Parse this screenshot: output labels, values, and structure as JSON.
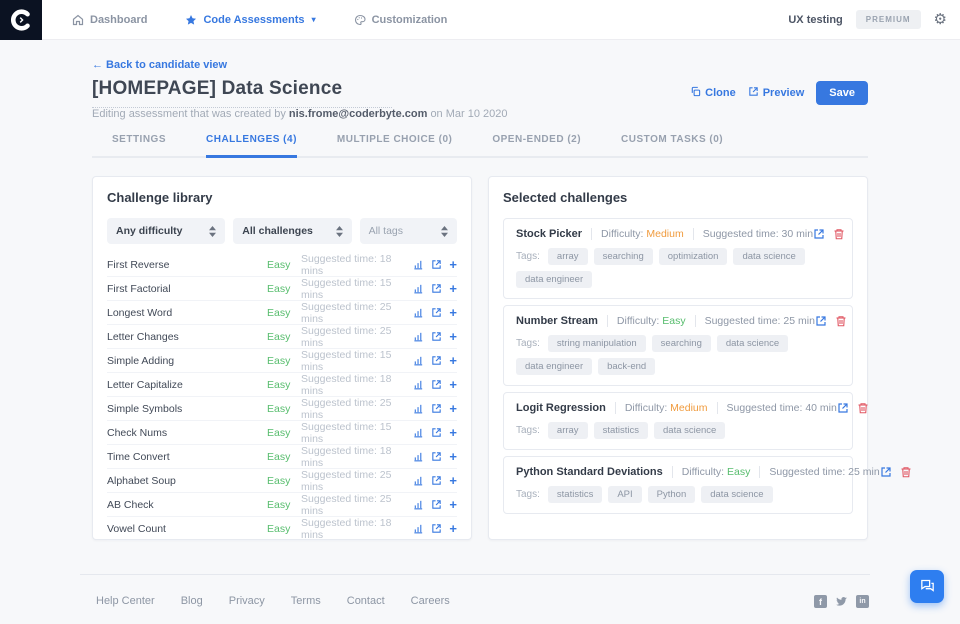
{
  "navbar": {
    "logo_icon": "coderbyte-logo",
    "items": [
      {
        "label": "Dashboard",
        "icon": "home-icon"
      },
      {
        "label": "Code Assessments",
        "icon": "star-icon",
        "has_caret": true
      },
      {
        "label": "Customization",
        "icon": "palette-icon"
      }
    ],
    "workspace": "UX testing",
    "plan_badge": "PREMIUM",
    "settings_icon": "gear-icon"
  },
  "header": {
    "back_link": "← Back to candidate view",
    "title": "[HOMEPAGE] Data Science",
    "subtitle_prefix": "Editing assessment that was created by",
    "subtitle_email": "nis.frome@coderbyte.com",
    "subtitle_suffix": "on Mar 10 2020",
    "actions": {
      "clone": "Clone",
      "preview": "Preview",
      "save": "Save"
    }
  },
  "tabs": [
    {
      "label": "SETTINGS",
      "active": false
    },
    {
      "label": "CHALLENGES (4)",
      "active": true
    },
    {
      "label": "MULTIPLE CHOICE (0)",
      "active": false
    },
    {
      "label": "OPEN-ENDED (2)",
      "active": false
    },
    {
      "label": "CUSTOM TASKS (0)",
      "active": false
    }
  ],
  "library": {
    "title": "Challenge library",
    "filters": [
      {
        "value": "Any difficulty"
      },
      {
        "value": "All challenges"
      },
      {
        "value": "All tags"
      }
    ],
    "challenges": [
      {
        "name": "First Reverse",
        "difficulty": "Easy",
        "time": "Suggested time: 18 mins"
      },
      {
        "name": "First Factorial",
        "difficulty": "Easy",
        "time": "Suggested time: 15 mins"
      },
      {
        "name": "Longest Word",
        "difficulty": "Easy",
        "time": "Suggested time: 25 mins"
      },
      {
        "name": "Letter Changes",
        "difficulty": "Easy",
        "time": "Suggested time: 25 mins"
      },
      {
        "name": "Simple Adding",
        "difficulty": "Easy",
        "time": "Suggested time: 15 mins"
      },
      {
        "name": "Letter Capitalize",
        "difficulty": "Easy",
        "time": "Suggested time: 18 mins"
      },
      {
        "name": "Simple Symbols",
        "difficulty": "Easy",
        "time": "Suggested time: 25 mins"
      },
      {
        "name": "Check Nums",
        "difficulty": "Easy",
        "time": "Suggested time: 15 mins"
      },
      {
        "name": "Time Convert",
        "difficulty": "Easy",
        "time": "Suggested time: 18 mins"
      },
      {
        "name": "Alphabet Soup",
        "difficulty": "Easy",
        "time": "Suggested time: 25 mins"
      },
      {
        "name": "AB Check",
        "difficulty": "Easy",
        "time": "Suggested time: 25 mins"
      },
      {
        "name": "Vowel Count",
        "difficulty": "Easy",
        "time": "Suggested time: 18 mins"
      }
    ]
  },
  "selected": {
    "title": "Selected challenges",
    "tags_label": "Tags:",
    "difficulty_label": "Difficulty:",
    "cards": [
      {
        "name": "Stock Picker",
        "difficulty": "Medium",
        "difficulty_color": "#f09b3e",
        "time": "Suggested time: 30 min",
        "tags": [
          "array",
          "searching",
          "optimization",
          "data science",
          "data engineer"
        ]
      },
      {
        "name": "Number Stream",
        "difficulty": "Easy",
        "difficulty_color": "#57bd6d",
        "time": "Suggested time: 25 min",
        "tags": [
          "string manipulation",
          "searching",
          "data science",
          "data engineer",
          "back-end"
        ]
      },
      {
        "name": "Logit Regression",
        "difficulty": "Medium",
        "difficulty_color": "#f09b3e",
        "time": "Suggested time: 40 min",
        "tags": [
          "array",
          "statistics",
          "data science"
        ]
      },
      {
        "name": "Python Standard Deviations",
        "difficulty": "Easy",
        "difficulty_color": "#57bd6d",
        "time": "Suggested time: 25 min",
        "tags": [
          "statistics",
          "API",
          "Python",
          "data science"
        ]
      }
    ]
  },
  "footer": {
    "links": [
      "Help Center",
      "Blog",
      "Privacy",
      "Terms",
      "Contact",
      "Careers"
    ],
    "social": [
      "facebook-icon",
      "twitter-icon",
      "linkedin-icon"
    ]
  },
  "colors": {
    "accent_blue": "#3778e0",
    "easy_green": "#57bd6d",
    "medium_orange": "#f09b3e",
    "danger_red": "#e15864",
    "chat_blue": "#2e7ef0",
    "navbar_dark": "#0b1222"
  }
}
